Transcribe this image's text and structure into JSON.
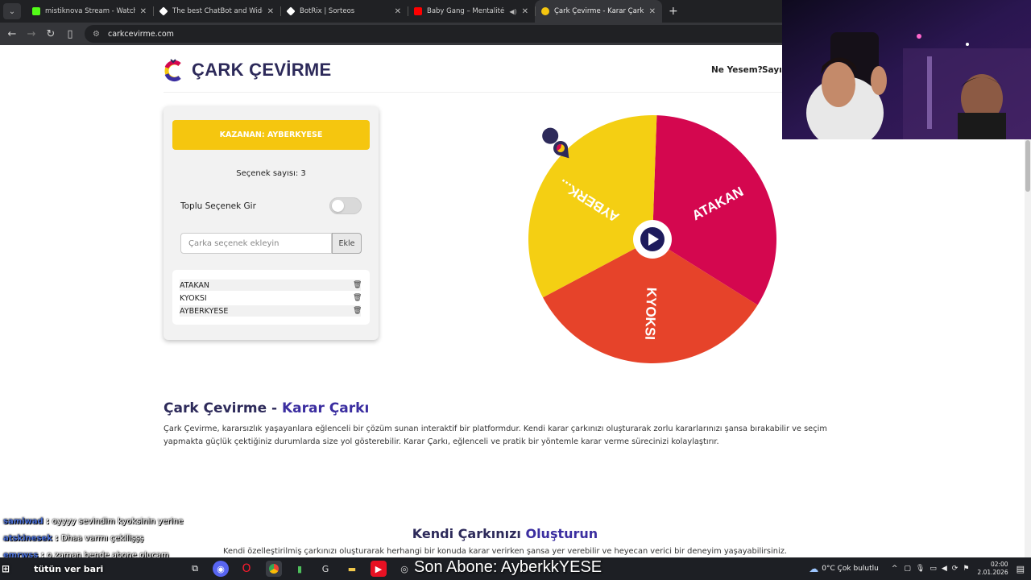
{
  "browser": {
    "tabs": [
      {
        "title": "mistiknova Stream - Watch Live",
        "favicon_color": "#53fc18",
        "active": false,
        "sound": false
      },
      {
        "title": "The best ChatBot and Widgets",
        "favicon_color": "#ffffff",
        "active": false,
        "sound": false
      },
      {
        "title": "BotRix | Sorteos",
        "favicon_color": "#ffffff",
        "active": false,
        "sound": false
      },
      {
        "title": "Baby Gang – Mentalité [Offi",
        "favicon_color": "#ff0000",
        "active": false,
        "sound": true
      },
      {
        "title": "Çark Çevirme - Karar Çarkı",
        "favicon_color": "#f5c60f",
        "active": true,
        "sound": false
      }
    ],
    "url": "carkcevirme.com",
    "new_tab_glyph": "+"
  },
  "site": {
    "title": "ÇARK ÇEVİRME",
    "nav": [
      "Ne Yesem?",
      "Sayı"
    ]
  },
  "panel": {
    "winner": "KAZANAN: AYBERKYESE",
    "option_count": "Seçenek sayısı: 3",
    "bulk_label": "Toplu Seçenek Gir",
    "bulk_enabled": false,
    "input_placeholder": "Çarka seçenek ekleyin",
    "add_button": "Ekle",
    "options": [
      "ATAKAN",
      "KYOKSI",
      "AYBERKYESE"
    ]
  },
  "wheel": {
    "segments": [
      {
        "label": "ATAKAN",
        "color": "#d4074f"
      },
      {
        "label": "KYOKSI",
        "color": "#e6432a"
      },
      {
        "label": "AYBERK...",
        "color": "#f4cf13"
      }
    ],
    "rotation_deg": 2
  },
  "content": {
    "h1_main": "Çark Çevirme - ",
    "h1_accent": "Karar Çarkı",
    "p1": "Çark Çevirme, kararsızlık yaşayanlara eğlenceli bir çözüm sunan interaktif bir platformdur. Kendi karar çarkınızı oluşturarak zorlu kararlarınızı şansa bırakabilir ve seçim yapmakta güçlük çektiğiniz durumlarda size yol gösterebilir. Karar Çarkı, eğlenceli ve pratik bir yöntemle karar verme sürecinizi kolaylaştırır.",
    "h2_main": "Kendi Çarkınızı ",
    "h2_accent": "Oluşturun",
    "p2": "Kendi özelleştirilmiş çarkınızı oluşturarak herhangi bir konuda karar verirken şansa yer verebilir ve heyecan verici bir deneyim yaşayabilirsiniz."
  },
  "stream_overlay": {
    "chat": [
      {
        "user": "samiwad",
        "msg": "oyyyy sevindim kyoksinin yerine"
      },
      {
        "user": "atskinesek",
        "msg": "Dhaa varmı çekilişşş"
      },
      {
        "user": "emrwss",
        "msg": "o zaman bende abone olucam"
      }
    ],
    "ticker": "tütün ver bari",
    "sub_alert": "Son Abone: AyberkkYESE"
  },
  "taskbar": {
    "weather": "0°C  Çok bulutlu",
    "time": "02:00",
    "date": "2.01.2026"
  }
}
